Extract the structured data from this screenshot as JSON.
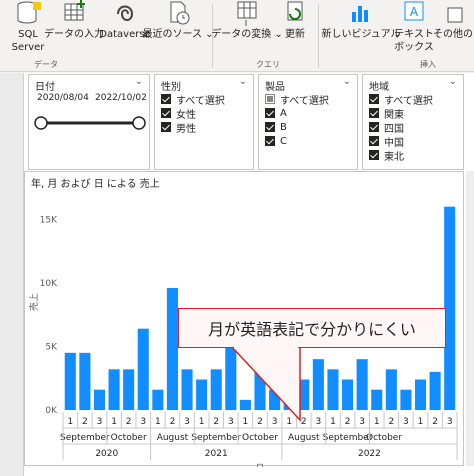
{
  "ribbon": {
    "buttons": [
      {
        "label": "SQL\nServer",
        "icon": "sql-server-icon"
      },
      {
        "label": "データの入力",
        "icon": "enter-data-icon"
      },
      {
        "label": "Dataverse",
        "icon": "dataverse-icon"
      },
      {
        "label": "最近のソース",
        "icon": "recent-sources-icon"
      },
      {
        "label": "データの変換",
        "icon": "transform-data-icon"
      },
      {
        "label": "更新",
        "icon": "refresh-icon"
      },
      {
        "label": "新しいビジュアル",
        "icon": "new-visual-icon"
      },
      {
        "label": "テキスト\nボックス",
        "icon": "text-box-icon"
      },
      {
        "label": "その他の",
        "icon": "more-visuals-icon"
      }
    ],
    "groups": {
      "data": "データ",
      "query": "クエリ",
      "insert": "挿入"
    }
  },
  "slicers": {
    "date": {
      "title": "日付",
      "from": "2020/08/04",
      "to": "2022/10/02"
    },
    "gender": {
      "title": "性別",
      "items": [
        "すべて選択",
        "女性",
        "男性"
      ]
    },
    "product": {
      "title": "製品",
      "items": [
        "すべて選択",
        "A",
        "B",
        "C"
      ]
    },
    "region": {
      "title": "地域",
      "items": [
        "すべて選択",
        "関東",
        "四国",
        "中国",
        "東北"
      ]
    }
  },
  "chart_data": {
    "type": "bar",
    "title": "年, 月 および 日 による 売上",
    "xlabel": "日",
    "ylabel": "売上",
    "ylim": [
      0,
      17000
    ],
    "yticks": [
      "0K",
      "5K",
      "10K",
      "15K"
    ],
    "color": "#118dff",
    "values": [
      4500,
      4500,
      1600,
      3200,
      3200,
      6400,
      1600,
      9600,
      3200,
      2400,
      3200,
      5600,
      800,
      4800,
      1600,
      800,
      2400,
      4000,
      3200,
      2400,
      4000,
      1600,
      3200,
      1600,
      2400,
      3000,
      16000
    ],
    "day_labels": [
      "1",
      "2",
      "3",
      "1",
      "2",
      "3",
      "1",
      "2",
      "3",
      "1",
      "2",
      "3",
      "1",
      "2",
      "3",
      "1",
      "2",
      "3",
      "1",
      "2",
      "3",
      "1",
      "2",
      "3",
      "1",
      "2",
      "3"
    ],
    "months": [
      {
        "label": "September",
        "span": 3
      },
      {
        "label": "October",
        "span": 3
      },
      {
        "label": "August",
        "span": 3
      },
      {
        "label": "September",
        "span": 3
      },
      {
        "label": "October",
        "span": 3
      },
      {
        "label": "August",
        "span": 3
      },
      {
        "label": "September",
        "span": 3
      },
      {
        "label": "October",
        "span": 2
      }
    ],
    "years": [
      {
        "label": "2020",
        "span": 6
      },
      {
        "label": "2021",
        "span": 9
      },
      {
        "label": "2022",
        "span": 12
      }
    ]
  },
  "callout": {
    "text": "月が英語表記で分かりにくい"
  }
}
